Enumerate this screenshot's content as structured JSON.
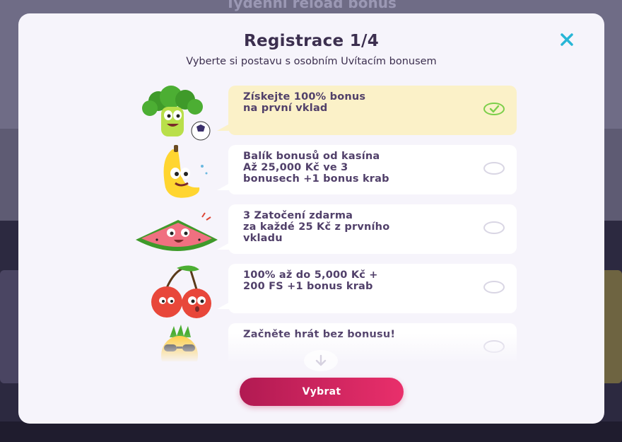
{
  "background": {
    "heading": "Týdenní reload bonus"
  },
  "modal": {
    "title": "Registrace 1/4",
    "subtitle": "Vyberte si postavu s osobním Uvítacím bonusem",
    "close_icon": "close-icon",
    "select_button": "Vybrat",
    "scroll_icon": "arrow-down-icon"
  },
  "options": [
    {
      "character": "broccoli",
      "line1": "Získejte 100% bonus",
      "line2": "na první vklad",
      "line3": "",
      "selected": true
    },
    {
      "character": "banana",
      "line1": "Balík bonusů od kasína",
      "line2": "Až 25,000 Kč ve 3",
      "line3": "bonusech +1 bonus krab",
      "selected": false
    },
    {
      "character": "watermelon",
      "line1": "3 Zatočení zdarma",
      "line2": "za každé 25 Kč z prvního",
      "line3": "vkladu",
      "selected": false
    },
    {
      "character": "cherries",
      "line1": "100% až do 5,000 Kč +",
      "line2": "200 FS +1 bonus krab",
      "line3": "",
      "selected": false
    },
    {
      "character": "pineapple",
      "line1": "Začněte hrát bez bonusu!",
      "line2": "",
      "line3": "",
      "selected": false
    }
  ],
  "colors": {
    "title": "#3c2f4f",
    "option_text": "#51406a",
    "selected_bubble": "#fbf1c8",
    "check": "#7ccf4a",
    "close": "#28b6d6",
    "button_start": "#b11a52",
    "button_end": "#e92f6b"
  }
}
